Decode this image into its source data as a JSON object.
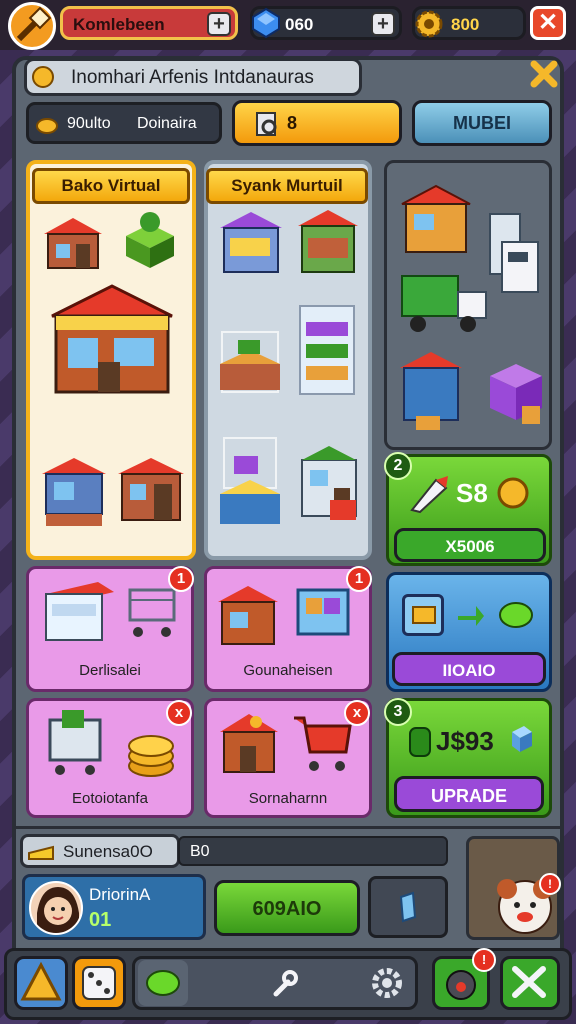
{
  "top_bar": {
    "player_name": "Komlebeen",
    "gems": "060",
    "coins": "800"
  },
  "panel": {
    "title": "Inomhari Arfenis Intdanauras",
    "stat_label": "90ulto",
    "stat_value": "Doinaira",
    "counter": "8",
    "mode_button": "MUBEI"
  },
  "shops": [
    {
      "ribbon": "Bako Virtual"
    },
    {
      "ribbon": "Syank Murtuil"
    }
  ],
  "offer1": {
    "badge": "2",
    "price": "S8",
    "button": "X5006"
  },
  "offer2": {
    "button": "IIOAIO"
  },
  "offer3": {
    "badge": "3",
    "price": "J$93",
    "button": "UPRADE"
  },
  "tiles": [
    {
      "label": "Derlisalei",
      "badge": "1"
    },
    {
      "label": "Gounaheisen",
      "badge": "1"
    },
    {
      "label": "Eotoiotanfa",
      "badge": "x"
    },
    {
      "label": "Sornaharnn",
      "badge": "x"
    }
  ],
  "footer": {
    "summary_label": "Sunensa0O",
    "summary_value": "B0",
    "player_name": "DriorinA",
    "player_level": "01",
    "action_button": "609AIO"
  },
  "colors": {
    "gold": "#f3a80c",
    "green": "#5fb82a",
    "purple": "#e99ae8",
    "blue": "#3a8fd0"
  }
}
